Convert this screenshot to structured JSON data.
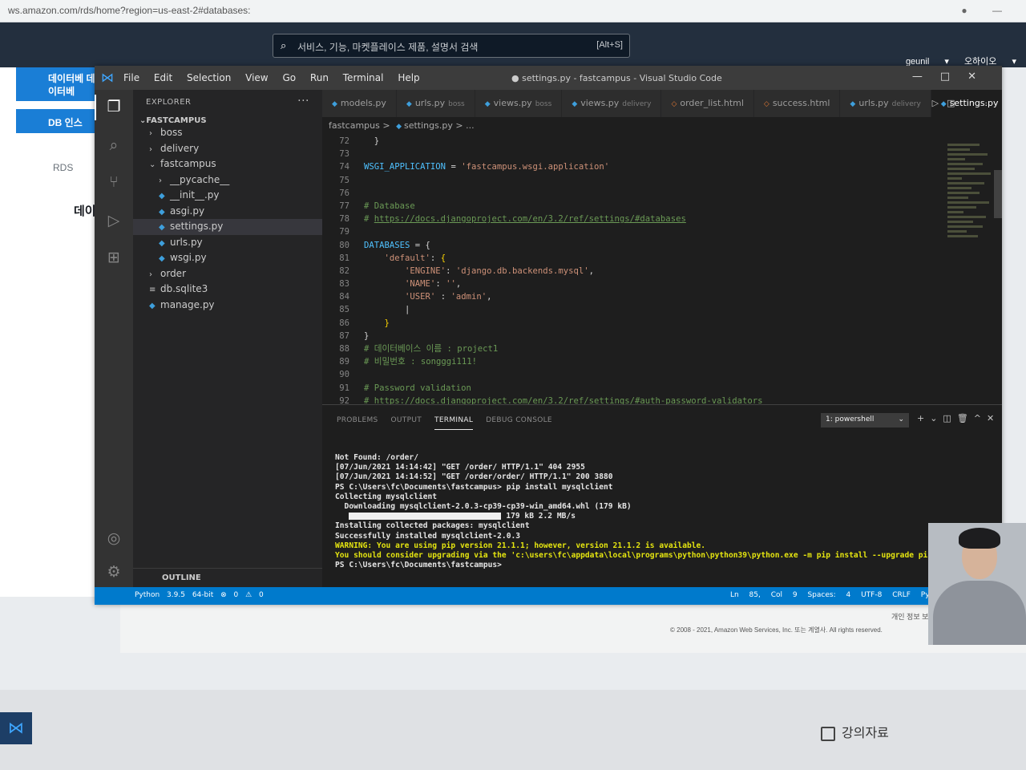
{
  "browser": {
    "url": "ws.amazon.com/rds/home?region=us-east-2#databases:",
    "search_placeholder": "서비스, 기능, 마켓플레이스 제품, 설명서 검색",
    "search_shortcut": "[Alt+S]",
    "user": "geunil ▾",
    "region": "오하이오 ▾"
  },
  "aws": {
    "nav_item_1": "데이터베\n데이터베",
    "nav_item_2": "DB 인스",
    "breadcrumb": "RDS",
    "heading": "데이",
    "copyright": "© 2008 - 2021, Amazon Web Services, Inc. 또는 계열사. All rights reserved.",
    "privacy": "개인 정보 보호"
  },
  "taskbar": {
    "material_label": "강의자료"
  },
  "vscode": {
    "menu": [
      "File",
      "Edit",
      "Selection",
      "View",
      "Go",
      "Run",
      "Terminal",
      "Help"
    ],
    "window_title": "● settings.py - fastcampus - Visual Studio Code",
    "explorer": {
      "header": "EXPLORER",
      "project": "FASTCAMPUS",
      "items": [
        {
          "label": "boss",
          "kind": "folder",
          "depth": 1
        },
        {
          "label": "delivery",
          "kind": "folder",
          "depth": 1
        },
        {
          "label": "fastcampus",
          "kind": "folder-open",
          "depth": 1
        },
        {
          "label": "__pycache__",
          "kind": "folder",
          "depth": 2
        },
        {
          "label": "__init__.py",
          "kind": "py",
          "depth": 2
        },
        {
          "label": "asgi.py",
          "kind": "py",
          "depth": 2
        },
        {
          "label": "settings.py",
          "kind": "py",
          "depth": 2,
          "selected": true
        },
        {
          "label": "urls.py",
          "kind": "py",
          "depth": 2
        },
        {
          "label": "wsgi.py",
          "kind": "py",
          "depth": 2
        },
        {
          "label": "order",
          "kind": "folder",
          "depth": 1
        },
        {
          "label": "db.sqlite3",
          "kind": "db",
          "depth": 1
        },
        {
          "label": "manage.py",
          "kind": "py",
          "depth": 1
        }
      ],
      "outline": "OUTLINE"
    },
    "tabs": [
      {
        "label": "models.py",
        "desc": "",
        "icon": "py"
      },
      {
        "label": "urls.py",
        "desc": "boss",
        "icon": "py"
      },
      {
        "label": "views.py",
        "desc": "boss",
        "icon": "py"
      },
      {
        "label": "views.py",
        "desc": "delivery",
        "icon": "py"
      },
      {
        "label": "order_list.html",
        "desc": "",
        "icon": "html"
      },
      {
        "label": "success.html",
        "desc": "",
        "icon": "html"
      },
      {
        "label": "urls.py",
        "desc": "delivery",
        "icon": "py"
      },
      {
        "label": "settings.py",
        "desc": "●",
        "icon": "py",
        "active": true
      }
    ],
    "breadcrumb": {
      "folder": "fastcampus",
      "file": "settings.py",
      "tail": "> ..."
    },
    "code": [
      {
        "n": "72",
        "parts": [
          [
            "op",
            "  }"
          ]
        ]
      },
      {
        "n": "73",
        "parts": []
      },
      {
        "n": "74",
        "parts": [
          [
            "var",
            "WSGI_APPLICATION"
          ],
          [
            "op",
            " = "
          ],
          [
            "str",
            "'fastcampus.wsgi.application'"
          ]
        ]
      },
      {
        "n": "75",
        "parts": []
      },
      {
        "n": "76",
        "parts": []
      },
      {
        "n": "77",
        "parts": [
          [
            "com",
            "# Database"
          ]
        ]
      },
      {
        "n": "78",
        "parts": [
          [
            "com",
            "# "
          ],
          [
            "url",
            "https://docs.djangoproject.com/en/3.2/ref/settings/#databases"
          ]
        ]
      },
      {
        "n": "79",
        "parts": []
      },
      {
        "n": "80",
        "parts": [
          [
            "var",
            "DATABASES"
          ],
          [
            "op",
            " = {"
          ]
        ]
      },
      {
        "n": "81",
        "parts": [
          [
            "op",
            "    "
          ],
          [
            "str",
            "'default'"
          ],
          [
            "op",
            ": "
          ],
          [
            "brk",
            "{"
          ]
        ]
      },
      {
        "n": "82",
        "parts": [
          [
            "op",
            "        "
          ],
          [
            "str",
            "'ENGINE'"
          ],
          [
            "op",
            ": "
          ],
          [
            "str",
            "'django.db.backends.mysql'"
          ],
          [
            "op",
            ","
          ]
        ]
      },
      {
        "n": "83",
        "parts": [
          [
            "op",
            "        "
          ],
          [
            "str",
            "'NAME'"
          ],
          [
            "op",
            ": "
          ],
          [
            "str",
            "''"
          ],
          [
            "op",
            ","
          ]
        ]
      },
      {
        "n": "84",
        "parts": [
          [
            "op",
            "        "
          ],
          [
            "str",
            "'USER'"
          ],
          [
            "op",
            " : "
          ],
          [
            "str",
            "'admin'"
          ],
          [
            "op",
            ","
          ]
        ]
      },
      {
        "n": "85",
        "parts": [
          [
            "op",
            "        |"
          ]
        ]
      },
      {
        "n": "86",
        "parts": [
          [
            "op",
            "    "
          ],
          [
            "brk",
            "}"
          ]
        ]
      },
      {
        "n": "87",
        "parts": [
          [
            "op",
            "}"
          ]
        ]
      },
      {
        "n": "88",
        "parts": [
          [
            "com",
            "# 데이터베이스 이름 : project1"
          ]
        ]
      },
      {
        "n": "89",
        "parts": [
          [
            "com",
            "# 비밀번호 : songggi111!"
          ]
        ]
      },
      {
        "n": "90",
        "parts": []
      },
      {
        "n": "91",
        "parts": [
          [
            "com",
            "# Password validation"
          ]
        ]
      },
      {
        "n": "92",
        "parts": [
          [
            "com",
            "# "
          ],
          [
            "url",
            "https://docs.djangoproject.com/en/3.2/ref/settings/#auth-password-validators"
          ]
        ]
      }
    ],
    "panel": {
      "tabs": [
        "PROBLEMS",
        "OUTPUT",
        "TERMINAL",
        "DEBUG CONSOLE"
      ],
      "active_tab": "TERMINAL",
      "terminal_select": "1: powershell",
      "lines": [
        "Not Found: /order/",
        "[07/Jun/2021 14:14:42] \"GET /order/ HTTP/1.1\" 404 2955",
        "[07/Jun/2021 14:14:52] \"GET /order/order/ HTTP/1.1\" 200 3880",
        "PS C:\\Users\\fc\\Documents\\fastcampus> pip install mysqlclient",
        "Collecting mysqlclient",
        "  Downloading mysqlclient-2.0.3-cp39-cp39-win_amd64.whl (179 kB)",
        "     179 kB 2.2 MB/s",
        "Installing collected packages: mysqlclient",
        "Successfully installed mysqlclient-2.0.3",
        "WARNING: You are using pip version 21.1.1; however, version 21.1.2 is available.",
        "You should consider upgrading via the 'c:\\users\\fc\\appdata\\local\\programs\\python\\python39\\python.exe -m pip install --upgrade pip' command.",
        "PS C:\\Users\\fc\\Documents\\fastcampus> "
      ],
      "download_progress": 1.0
    },
    "status": {
      "python": "Python 3.9.5 64-bit",
      "problems": "⊗ 0 ⚠ 0",
      "cursor": "Ln 85, Col 9",
      "spaces": "Spaces: 4",
      "encoding": "UTF-8",
      "eol": "CRLF",
      "lang": "Python"
    }
  }
}
